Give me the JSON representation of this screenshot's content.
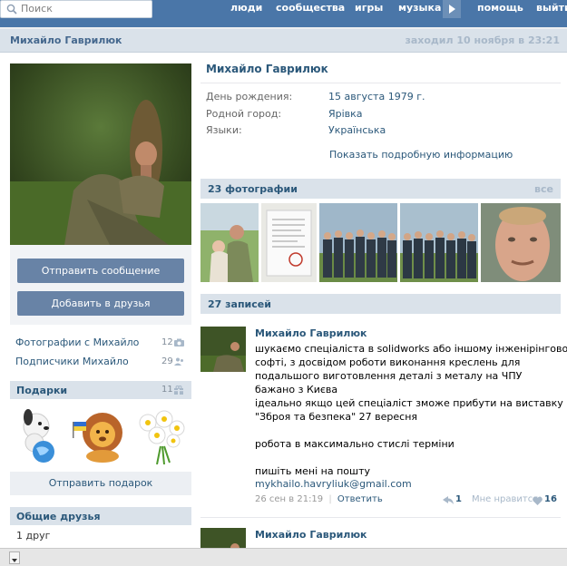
{
  "search": {
    "placeholder": "Поиск"
  },
  "nav": [
    {
      "label": "люди"
    },
    {
      "label": "сообщества"
    },
    {
      "label": "игры"
    },
    {
      "label": "музыка"
    },
    {
      "label": "помощь"
    },
    {
      "label": "выйти"
    }
  ],
  "header": {
    "name": "Михайло Гаврилюк",
    "last_seen": "заходил 10 ноября в 23:21"
  },
  "profile": {
    "name": "Михайло Гаврилюк",
    "fields": [
      {
        "label": "День рождения:",
        "value": "15 августа 1979 г."
      },
      {
        "label": "Родной город:",
        "value": "Ярівка"
      },
      {
        "label": "Языки:",
        "value": "Українська"
      }
    ],
    "more_info": "Показать подробную информацию"
  },
  "actions": {
    "send_message": "Отправить сообщение",
    "add_friend": "Добавить в друзья"
  },
  "sidebar": {
    "photos_with": {
      "label": "Фотографии с Михайло",
      "count": "12"
    },
    "followers": {
      "label": "Подписчики Михайло",
      "count": "29"
    },
    "gifts": {
      "title": "Подарки",
      "count": "11",
      "send_label": "Отправить подарок"
    },
    "friends": {
      "title": "Общие друзья",
      "count_text": "1 друг"
    }
  },
  "photos": {
    "title": "23 фотографии",
    "all_label": "все"
  },
  "wall": {
    "title": "27 записей",
    "posts": [
      {
        "author": "Михайло Гаврилюк",
        "lines": [
          "шукаємо спеціаліста в solidworks або іншому інженірінговому",
          "софті, з досвідом роботи виконання креслень для",
          "подальшого виготовлення деталі з металу на ЧПУ",
          "бажано з Києва",
          "ідеально якщо цей спеціаліст зможе прибути на виставку",
          "\"Зброя та безпека\" 27 вересня",
          "",
          "робота в максимально стислі терміни",
          "",
          "пишіть мені на пошту"
        ],
        "link": "mykhailo.havryliuk@gmail.com",
        "date": "26 сен в 21:19",
        "separator": "|",
        "reply": "Ответить",
        "reposts": "1",
        "like_label": "Мне нравится",
        "likes": "16"
      },
      {
        "author": "Михайло Гаврилюк"
      }
    ]
  },
  "colors": {
    "topbar": "#4a76a8",
    "link": "#2b587a",
    "button": "#6883a6",
    "section": "#dae2ea"
  }
}
